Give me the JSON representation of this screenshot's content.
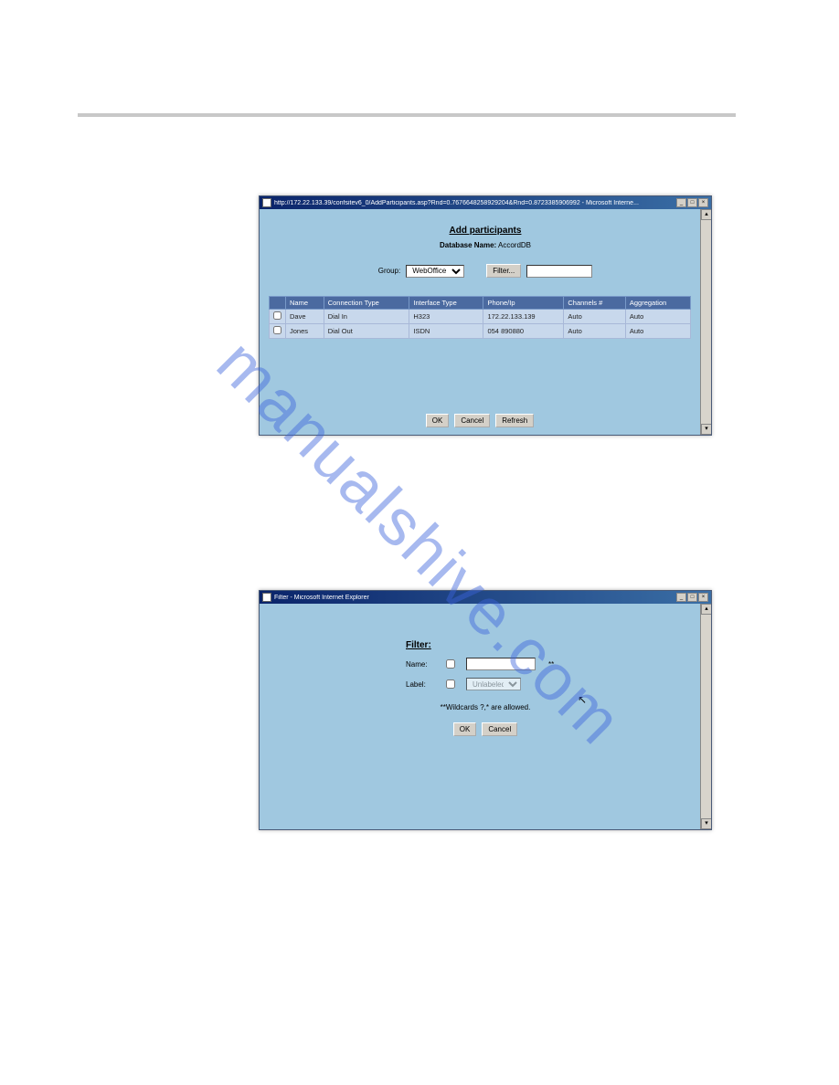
{
  "watermark": "manualshive.com",
  "intro_text": "",
  "window1": {
    "title": "http://172.22.133.39/confsitev6_0/AddParticipants.asp?Rnd=0.7676648258929204&Rnd=0.8723385906992 - Microsoft Interne...",
    "heading": "Add participants",
    "db_label": "Database Name:",
    "db_value": "AccordDB",
    "group_label": "Group:",
    "group_value": "WebOffice",
    "filter_btn": "Filter...",
    "filter_value": "",
    "columns": [
      "",
      "Name",
      "Connection Type",
      "Interface Type",
      "Phone/Ip",
      "Channels #",
      "Aggregation"
    ],
    "rows": [
      {
        "name": "Dave",
        "conn": "Dial In",
        "iface": "H323",
        "phone": "172.22.133.139",
        "channels": "Auto",
        "agg": "Auto"
      },
      {
        "name": "Jones",
        "conn": "Dial Out",
        "iface": "ISDN",
        "phone": "054 890880",
        "channels": "Auto",
        "agg": "Auto"
      }
    ],
    "ok": "OK",
    "cancel": "Cancel",
    "refresh": "Refresh"
  },
  "mid_text1": "",
  "filter_step": "",
  "window2": {
    "title": "Filter - Microsoft Internet Explorer",
    "heading": "Filter:",
    "name_label": "Name:",
    "name_value": "",
    "label_label": "Label:",
    "label_value": "Unlabeled",
    "wildcards": "**Wildcards ?,* are allowed.",
    "ok": "OK",
    "cancel": "Cancel",
    "star": "**"
  },
  "blank": " "
}
